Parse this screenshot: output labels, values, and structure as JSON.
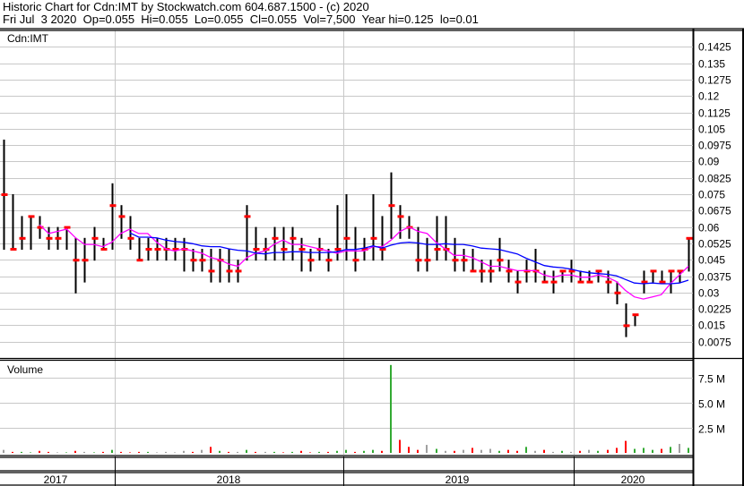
{
  "header": {
    "title": "Historic Chart for Cdn:IMT by Stockwatch.com 604.687.1500 - (c) 2020",
    "quote": "Fri Jul  3 2020  Op=0.055  Hi=0.055  Lo=0.055  Cl=0.055  Vol=7,500  Year hi=0.125  lo=0.01"
  },
  "chart_data": [
    {
      "type": "line",
      "title": "Cdn:IMT",
      "subtype": "ohlc-bars with moving averages",
      "ylim": [
        0,
        0.15
      ],
      "y_ticks": [
        "0.1425",
        "0.135",
        "0.1275",
        "0.12",
        "0.1125",
        "0.105",
        "0.0975",
        "0.09",
        "0.0825",
        "0.075",
        "0.0675",
        "0.06",
        "0.0525",
        "0.045",
        "0.0375",
        "0.03",
        "0.0225",
        "0.015",
        "0.0075"
      ],
      "x_years": [
        "2017",
        "2018",
        "2019",
        "2020"
      ],
      "period": "approx. two-week bars, mid-2017 to Jul 2020",
      "close": [
        0.075,
        0.05,
        0.055,
        0.065,
        0.06,
        0.055,
        0.055,
        0.06,
        0.045,
        0.045,
        0.055,
        0.05,
        0.07,
        0.065,
        0.055,
        0.045,
        0.05,
        0.05,
        0.05,
        0.05,
        0.05,
        0.045,
        0.045,
        0.04,
        0.045,
        0.04,
        0.04,
        0.065,
        0.05,
        0.05,
        0.055,
        0.05,
        0.055,
        0.05,
        0.045,
        0.05,
        0.045,
        0.05,
        0.055,
        0.045,
        0.05,
        0.055,
        0.05,
        0.07,
        0.065,
        0.06,
        0.045,
        0.045,
        0.05,
        0.05,
        0.045,
        0.045,
        0.04,
        0.04,
        0.04,
        0.045,
        0.04,
        0.035,
        0.04,
        0.04,
        0.035,
        0.035,
        0.04,
        0.04,
        0.035,
        0.035,
        0.04,
        0.035,
        0.03,
        0.015,
        0.02,
        0.035,
        0.04,
        0.035,
        0.04,
        0.04,
        0.055
      ],
      "high": [
        0.1,
        0.075,
        0.065,
        0.065,
        0.065,
        0.06,
        0.06,
        0.06,
        0.055,
        0.055,
        0.06,
        0.055,
        0.08,
        0.07,
        0.065,
        0.055,
        0.055,
        0.055,
        0.055,
        0.055,
        0.055,
        0.05,
        0.05,
        0.05,
        0.05,
        0.05,
        0.045,
        0.07,
        0.06,
        0.055,
        0.06,
        0.06,
        0.06,
        0.055,
        0.05,
        0.055,
        0.05,
        0.07,
        0.075,
        0.06,
        0.055,
        0.075,
        0.065,
        0.085,
        0.07,
        0.065,
        0.06,
        0.055,
        0.065,
        0.065,
        0.055,
        0.05,
        0.05,
        0.045,
        0.045,
        0.055,
        0.045,
        0.04,
        0.045,
        0.05,
        0.04,
        0.04,
        0.04,
        0.045,
        0.04,
        0.04,
        0.04,
        0.04,
        0.035,
        0.025,
        0.02,
        0.04,
        0.04,
        0.04,
        0.04,
        0.04,
        0.055
      ],
      "low": [
        0.05,
        0.05,
        0.05,
        0.05,
        0.055,
        0.05,
        0.05,
        0.05,
        0.03,
        0.035,
        0.045,
        0.05,
        0.05,
        0.055,
        0.05,
        0.045,
        0.045,
        0.045,
        0.045,
        0.045,
        0.04,
        0.04,
        0.04,
        0.035,
        0.035,
        0.035,
        0.035,
        0.045,
        0.045,
        0.045,
        0.045,
        0.045,
        0.045,
        0.04,
        0.04,
        0.045,
        0.04,
        0.045,
        0.045,
        0.04,
        0.045,
        0.045,
        0.045,
        0.055,
        0.055,
        0.055,
        0.04,
        0.04,
        0.045,
        0.045,
        0.04,
        0.04,
        0.04,
        0.035,
        0.035,
        0.04,
        0.035,
        0.03,
        0.035,
        0.035,
        0.035,
        0.03,
        0.035,
        0.035,
        0.035,
        0.035,
        0.035,
        0.03,
        0.025,
        0.01,
        0.015,
        0.03,
        0.035,
        0.035,
        0.03,
        0.035,
        0.04
      ],
      "ma_short_periods": 5,
      "ma_long_periods": 15,
      "colors": {
        "bar": "#000000",
        "close": "#ff0000",
        "ma_short": "#ff00ff",
        "ma_long": "#0000ff",
        "grid": "#c8c8c8"
      }
    },
    {
      "type": "bar",
      "title": "Volume",
      "ylim": [
        0,
        9500000
      ],
      "y_ticks": [
        "7.5 M",
        "5.0 M",
        "2.5 M"
      ],
      "y_tick_values": [
        7500000,
        5000000,
        2500000
      ],
      "values_millions": [
        0.3,
        0.1,
        0.1,
        0.05,
        0.2,
        0.1,
        0.05,
        0.05,
        0.2,
        0.1,
        0.05,
        0.1,
        0.3,
        0.1,
        0.05,
        0.1,
        0.1,
        0.05,
        0.1,
        0.05,
        0.2,
        0.1,
        0.3,
        0.6,
        0.2,
        0.1,
        0.1,
        0.3,
        0.1,
        0.1,
        0.1,
        0.05,
        0.1,
        0.2,
        0.05,
        0.1,
        0.1,
        0.2,
        0.3,
        0.1,
        0.2,
        0.3,
        0.2,
        8.8,
        1.3,
        0.6,
        0.3,
        0.8,
        0.4,
        0.2,
        0.2,
        0.3,
        0.5,
        0.3,
        0.4,
        0.2,
        0.3,
        0.2,
        0.6,
        0.2,
        0.3,
        0.1,
        0.2,
        0.1,
        0.2,
        0.3,
        0.2,
        0.3,
        0.5,
        1.2,
        0.4,
        0.5,
        0.3,
        0.4,
        0.6,
        0.9,
        0.5
      ],
      "colors": {
        "up": "#33aa33",
        "down": "#ff0000",
        "flat": "#a0a0a0"
      }
    }
  ]
}
